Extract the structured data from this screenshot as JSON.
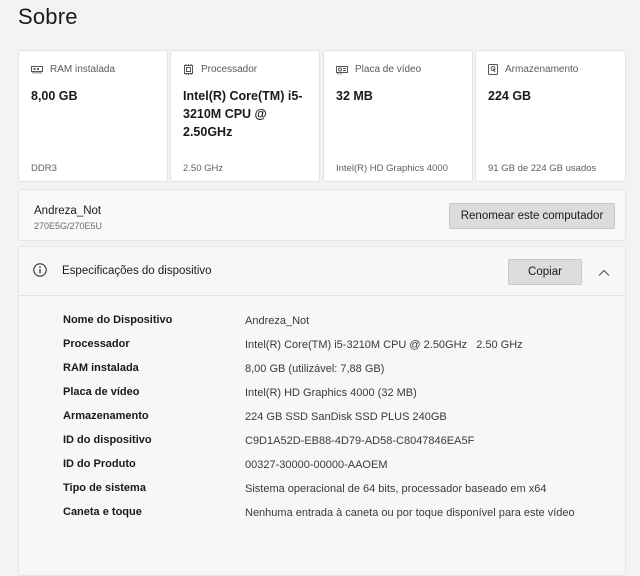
{
  "page": {
    "title": "Sobre"
  },
  "cards": [
    {
      "label": "RAM instalada",
      "icon": "ram-icon",
      "value": "8,00 GB",
      "footer": "DDR3"
    },
    {
      "label": "Processador",
      "icon": "processor-icon",
      "value": "Intel(R) Core(TM) i5-3210M CPU @ 2.50GHz",
      "footer": "2.50 GHz"
    },
    {
      "label": "Placa de vídeo",
      "icon": "gpu-icon",
      "value": "32 MB",
      "footer": "Intel(R) HD Graphics 4000"
    },
    {
      "label": "Armazenamento",
      "icon": "storage-icon",
      "value": "224 GB",
      "footer": "91 GB de 224 GB usados"
    }
  ],
  "device": {
    "name": "Andreza_Not",
    "model": "270E5G/270E5U",
    "rename_label": "Renomear este computador"
  },
  "specs": {
    "title": "Especificações do dispositivo",
    "copy_label": "Copiar",
    "rows": [
      {
        "label": "Nome do Dispositivo",
        "value": "Andreza_Not"
      },
      {
        "label": "Processador",
        "value": "Intel(R) Core(TM) i5-3210M CPU @ 2.50GHz   2.50 GHz"
      },
      {
        "label": "RAM instalada",
        "value": "8,00 GB (utilizável: 7,88 GB)"
      },
      {
        "label": "Placa de vídeo",
        "value": "Intel(R) HD Graphics 4000 (32 MB)"
      },
      {
        "label": "Armazenamento",
        "value": "224 GB SSD SanDisk SSD PLUS 240GB"
      },
      {
        "label": "ID do dispositivo",
        "value": "C9D1A52D-EB88-4D79-AD58-C8047846EA5F"
      },
      {
        "label": "ID do Produto",
        "value": "00327-30000-00000-AAOEM"
      },
      {
        "label": "Tipo de sistema",
        "value": "Sistema operacional de 64 bits, processador baseado em x64"
      },
      {
        "label": "Caneta e toque",
        "value": "Nenhuma entrada à caneta ou por toque disponível para este vídeo"
      }
    ]
  }
}
